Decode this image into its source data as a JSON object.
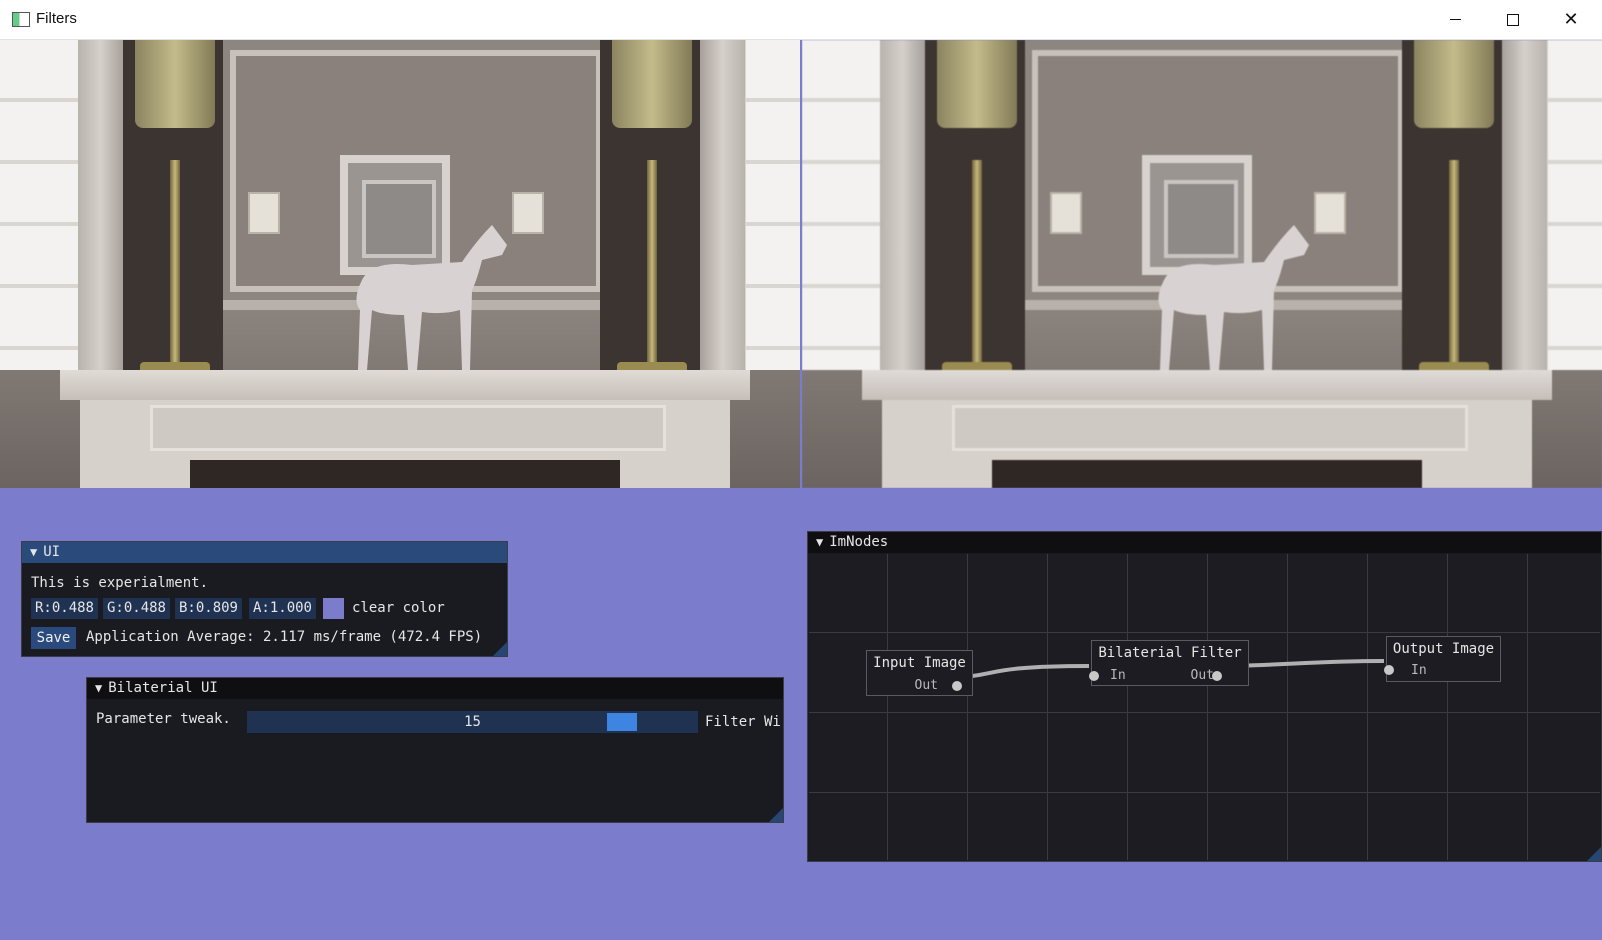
{
  "window": {
    "title": "Filters"
  },
  "titlebar_controls": {
    "minimize": "—",
    "maximize": "☐",
    "close": "✕"
  },
  "ui_panel": {
    "title": "UI",
    "text": "This is experialment.",
    "r": "R:0.488",
    "g": "G:0.488",
    "b": "B:0.809",
    "a": "A:1.000",
    "clear_color_label": "clear color",
    "clear_color": "#7b7ccc",
    "save_label": "Save",
    "perf": "Application Average: 2.117 ms/frame (472.4 FPS)"
  },
  "bilateral_panel": {
    "title": "Bilaterial UI",
    "param_label": "Parameter tweak.",
    "slider_value": "15",
    "slider_label": "Filter Wi"
  },
  "imnodes_panel": {
    "title": "ImNodes",
    "nodes": [
      {
        "title": "Input Image",
        "out": "Out"
      },
      {
        "title": "Bilaterial Filter",
        "in": "In",
        "out": "Out"
      },
      {
        "title": "Output Image",
        "in": "In"
      }
    ]
  }
}
